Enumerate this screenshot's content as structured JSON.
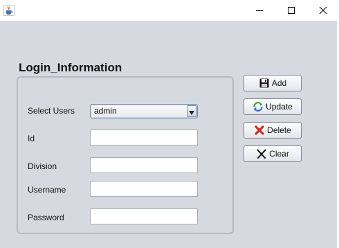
{
  "window": {
    "controls": {
      "minimize": "minimize-icon",
      "maximize": "maximize-icon",
      "close": "close-icon"
    },
    "app_icon": "java-cup-icon"
  },
  "panel": {
    "title": "Login_Information"
  },
  "form": {
    "select_users_label": "Select Users",
    "select_users_value": "admin",
    "id_label": "Id",
    "id_value": "",
    "division_label": "Division",
    "division_value": "",
    "username_label": "Username",
    "username_value": "",
    "password_label": "Password",
    "password_value": ""
  },
  "actions": {
    "add_label": "Add",
    "add_icon": "floppy-disk-icon",
    "update_label": "Update",
    "update_icon": "refresh-icon",
    "delete_label": "Delete",
    "delete_icon": "red-x-icon",
    "clear_label": "Clear",
    "clear_icon": "black-x-icon"
  },
  "colors": {
    "content_background": "#d6d9df",
    "delete_icon": "#d42a1e",
    "update_icon_green": "#3aa63a",
    "update_icon_blue": "#2c6fd1"
  }
}
